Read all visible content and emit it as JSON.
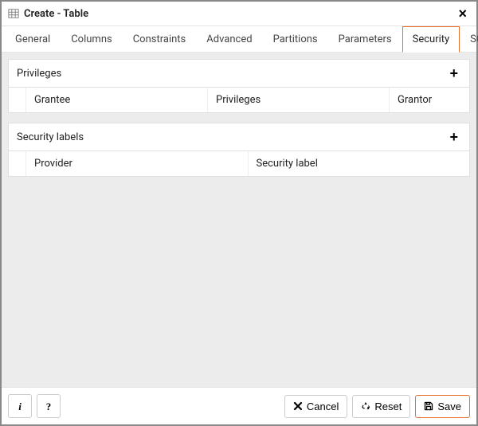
{
  "window": {
    "title": "Create - Table"
  },
  "tabs": {
    "general": "General",
    "columns": "Columns",
    "constraints": "Constraints",
    "advanced": "Advanced",
    "partitions": "Partitions",
    "parameters": "Parameters",
    "security": "Security",
    "sql": "SQL"
  },
  "sections": {
    "privileges": {
      "title": "Privileges",
      "columns": {
        "grantee": "Grantee",
        "privileges": "Privileges",
        "grantor": "Grantor"
      }
    },
    "securityLabels": {
      "title": "Security labels",
      "columns": {
        "provider": "Provider",
        "securityLabel": "Security label"
      }
    }
  },
  "footer": {
    "info": "i",
    "help": "?",
    "cancel": "Cancel",
    "reset": "Reset",
    "save": "Save"
  },
  "glyphs": {
    "plus": "+",
    "close": "×"
  }
}
